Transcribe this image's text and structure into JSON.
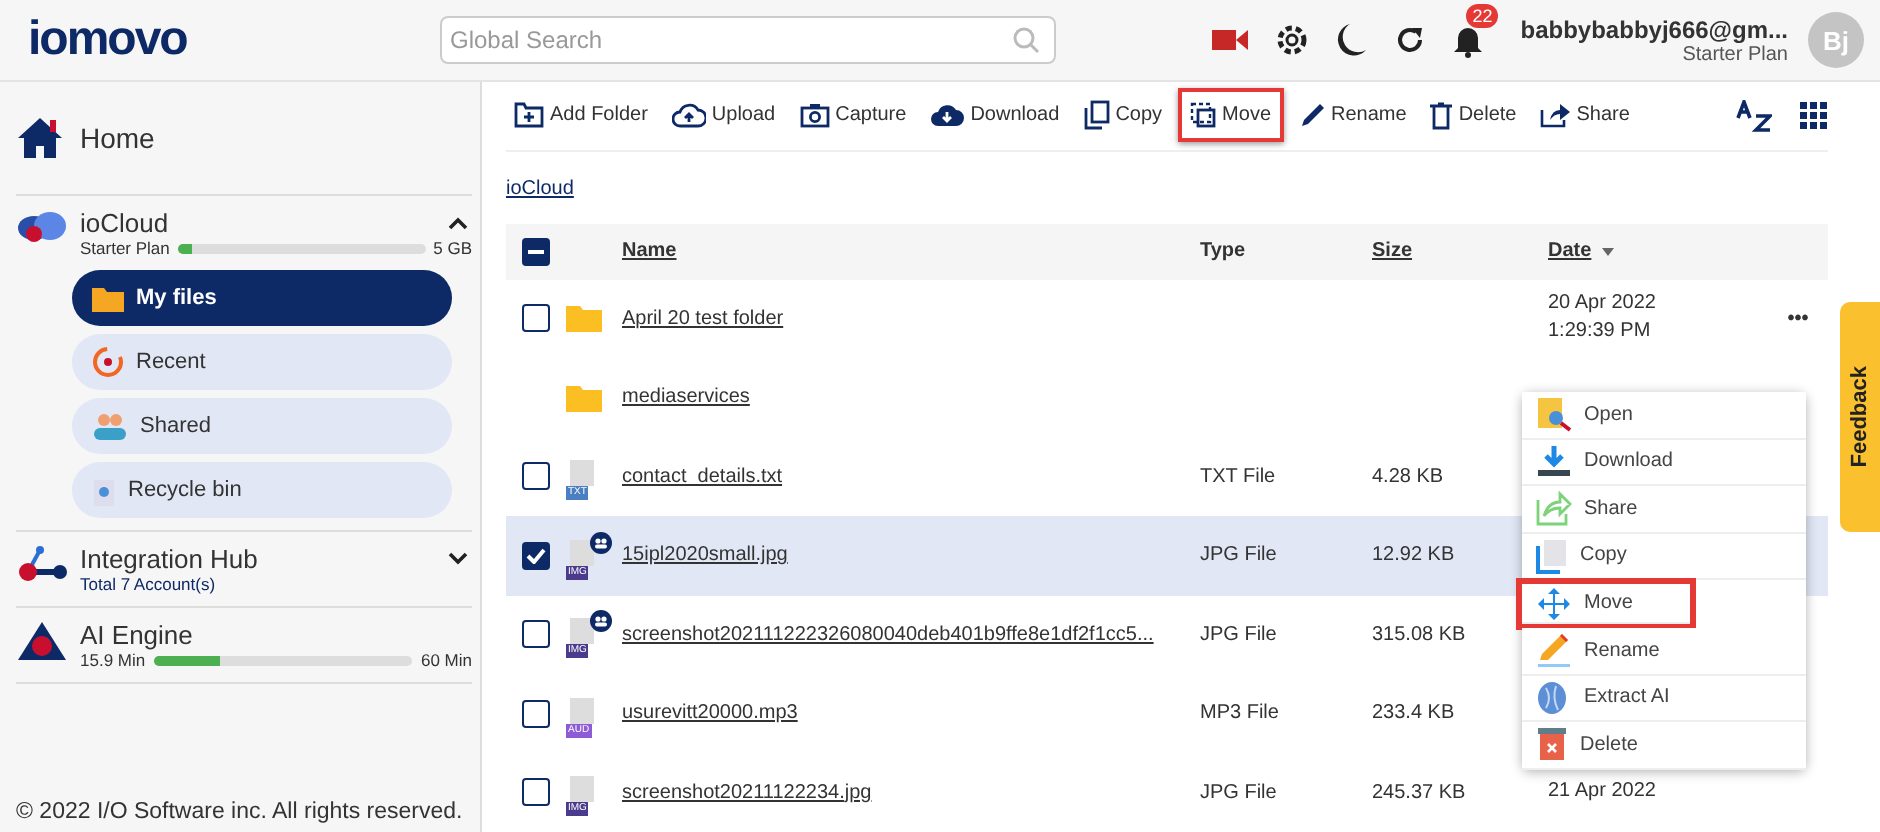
{
  "header": {
    "logo": "iomovo",
    "search": {
      "placeholder": "Global Search"
    },
    "notification_count": "22",
    "user": {
      "email": "babbybabbyj666@gm...",
      "plan": "Starter Plan",
      "avatar": "Bj"
    }
  },
  "sidebar": {
    "home": "Home",
    "cloud": {
      "title": "ioCloud",
      "plan": "Starter Plan",
      "level": 0.06,
      "quota": "5 GB",
      "expanded": true,
      "items": [
        {
          "label": "My files",
          "selected": true,
          "kind": "folder"
        },
        {
          "label": "Recent",
          "selected": false,
          "kind": "recent"
        },
        {
          "label": "Shared",
          "selected": false,
          "kind": "shared"
        },
        {
          "label": "Recycle bin",
          "selected": false,
          "kind": "bin"
        }
      ]
    },
    "hub": {
      "title": "Integration Hub",
      "subtitle": "Total 7 Account(s)",
      "expanded": false
    },
    "ai": {
      "title": "AI Engine",
      "used": "15.9 Min",
      "level": 0.26,
      "total": "60 Min"
    },
    "footer": "© 2022 I/O Software inc. All rights reserved."
  },
  "toolbar": [
    {
      "label": "Add Folder",
      "kind": "addfolder",
      "highlighted": false
    },
    {
      "label": "Upload",
      "kind": "upload",
      "highlighted": false
    },
    {
      "label": "Capture",
      "kind": "capture",
      "highlighted": false
    },
    {
      "label": "Download",
      "kind": "download",
      "highlighted": false
    },
    {
      "label": "Copy",
      "kind": "copy",
      "highlighted": false
    },
    {
      "label": "Move",
      "kind": "move",
      "highlighted": true
    },
    {
      "label": "Rename",
      "kind": "rename",
      "highlighted": false
    },
    {
      "label": "Delete",
      "kind": "delete",
      "highlighted": false
    },
    {
      "label": "Share",
      "kind": "share",
      "highlighted": false
    }
  ],
  "breadcrumb": "ioCloud",
  "table": {
    "select_all": {
      "indeterminate": true
    },
    "columns": [
      "Name",
      "Type",
      "Size",
      "Date"
    ],
    "rows": [
      {
        "kind": "folder",
        "checked": false,
        "name": "April 20 test folder",
        "date": "20 Apr 2022",
        "time": "1:29:39 PM",
        "more": "•••"
      },
      {
        "kind": "folder",
        "name": "mediaservices"
      },
      {
        "kind": "TXT",
        "checked": false,
        "shared": false,
        "name": "contact_details.txt",
        "type": "TXT File",
        "size": "4.28 KB"
      },
      {
        "kind": "IMG",
        "checked": true,
        "shared": true,
        "name": "15ipl2020small.jpg",
        "type": "JPG File",
        "size": "12.92 KB"
      },
      {
        "kind": "IMG",
        "checked": false,
        "shared": true,
        "name": "screenshot202111222326080040deb401b9ffe8e1df2f1cc5...",
        "type": "JPG File",
        "size": "315.08 KB"
      },
      {
        "kind": "AUD",
        "checked": false,
        "shared": false,
        "name": "usurevitt20000.mp3",
        "type": "MP3 File",
        "size": "233.4 KB"
      },
      {
        "kind": "IMG",
        "checked": false,
        "shared": false,
        "name": "screenshot20211122234.jpg",
        "type": "JPG File",
        "size": "245.37 KB",
        "date": "21 Apr 2022"
      }
    ]
  },
  "context_menu": [
    {
      "label": "Open",
      "kind": "open",
      "highlighted": false
    },
    {
      "label": "Download",
      "kind": "download",
      "highlighted": false
    },
    {
      "label": "Share",
      "kind": "share",
      "highlighted": false
    },
    {
      "label": "Copy",
      "kind": "copy",
      "highlighted": false
    },
    {
      "label": "Move",
      "kind": "move",
      "highlighted": true
    },
    {
      "label": "Rename",
      "kind": "rename",
      "highlighted": false
    },
    {
      "label": "Extract AI",
      "kind": "ai",
      "highlighted": false
    },
    {
      "label": "Delete",
      "kind": "delete",
      "highlighted": false
    }
  ],
  "feedback": "Feedback"
}
